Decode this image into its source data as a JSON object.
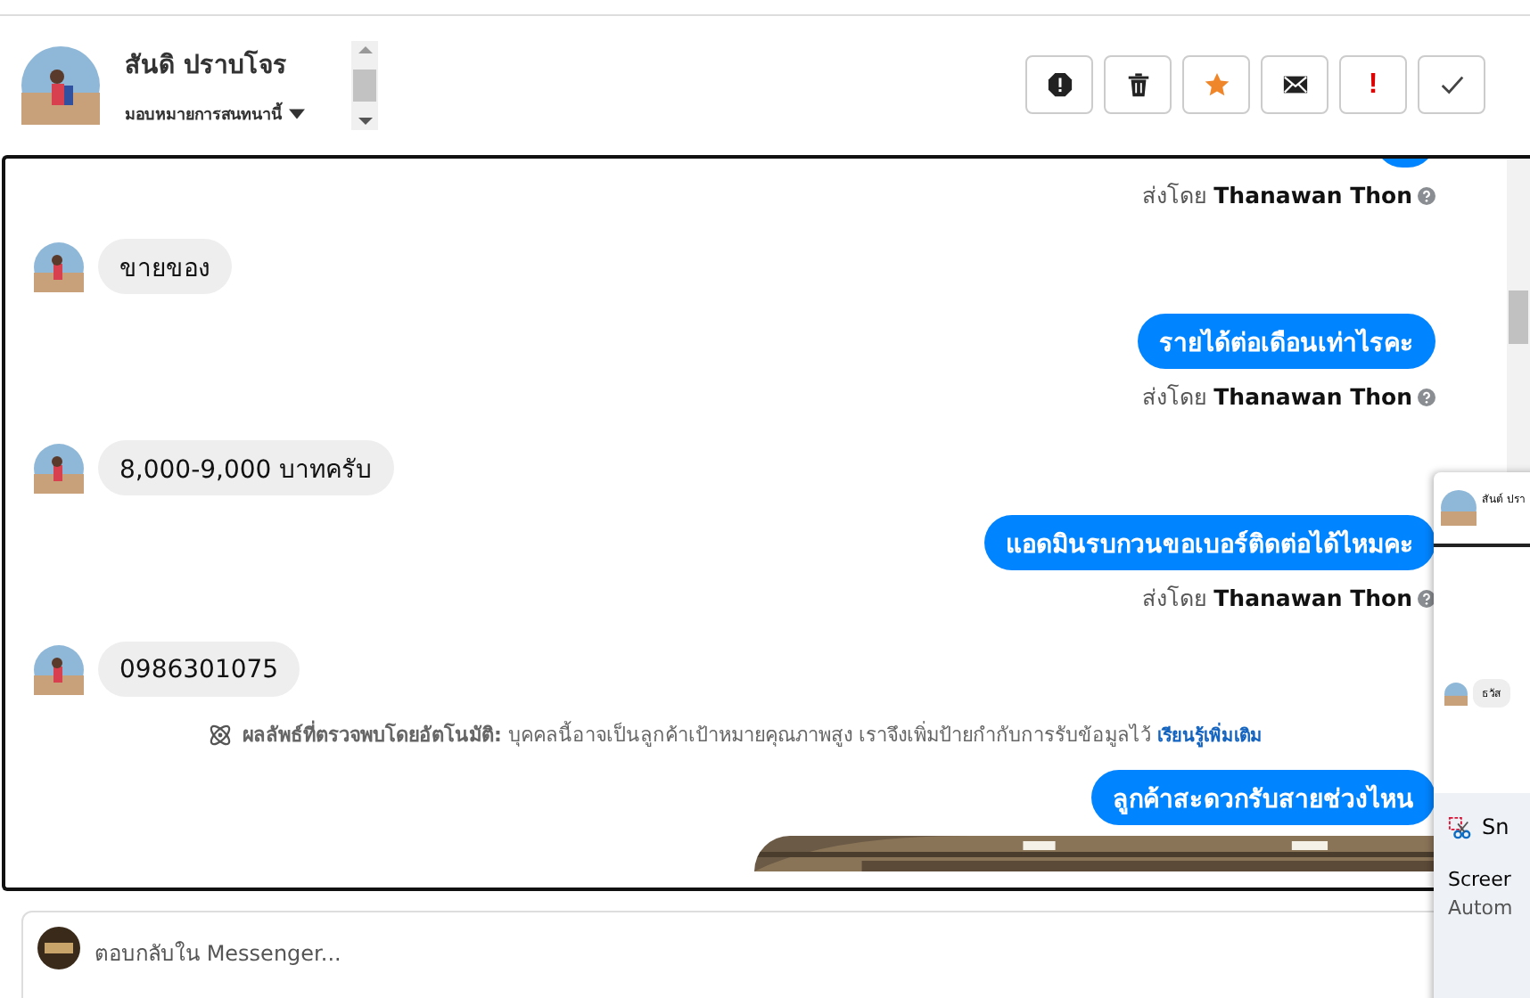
{
  "header": {
    "name": "สันดิ ปราบโจร",
    "assign": "มอบหมายการสนทนานี้",
    "actions": [
      {
        "kind": "alert"
      },
      {
        "kind": "trash"
      },
      {
        "kind": "star"
      },
      {
        "kind": "mail"
      },
      {
        "kind": "bang",
        "text": "!"
      },
      {
        "kind": "check"
      }
    ]
  },
  "messages": [
    {
      "kind": "outgoing"
    },
    {
      "kind": "sender",
      "prefix": "ส่งโดย",
      "name": "Thanawan Thon"
    },
    {
      "kind": "incoming",
      "text": "ขายของ"
    },
    {
      "kind": "outgoing",
      "text": "รายได้ต่อเดือนเท่าไรคะ"
    },
    {
      "kind": "sender",
      "prefix": "ส่งโดย",
      "name": "Thanawan Thon"
    },
    {
      "kind": "incoming",
      "text": "8,000-9,000 บาทครับ"
    },
    {
      "kind": "outgoing",
      "text": "แอดมินรบกวนขอเบอร์ติดต่อได้ไหมคะ"
    },
    {
      "kind": "sender",
      "prefix": "ส่งโดย",
      "name": "Thanawan Thon"
    },
    {
      "kind": "incoming",
      "text": "0986301075"
    },
    {
      "kind": "notice",
      "text": "**ผลลัพธ์ที่ตรวจพบโดยอัตโนมัติ:** บุคคลนี้อาจเป็นลูกค้าเป้าหมายคุณภาพสูง เราจึงเพิ่มป้ายกำกับการรับข้อมูลไว้",
      "link": "เรียนรู้เพิ่มเติม"
    },
    {
      "kind": "outgoing",
      "text": "ลูกค้าสะดวกรับสายช่วงไหน"
    },
    {
      "kind": "picture"
    }
  ],
  "composer": {
    "placeholder": "ตอบกลับใน Messenger..."
  },
  "overlay": {
    "title": "สันต์ ปรา",
    "reply": "ธวัส",
    "snip": {
      "app": "Sn",
      "line1": "Screer",
      "line2": "Autom"
    }
  }
}
